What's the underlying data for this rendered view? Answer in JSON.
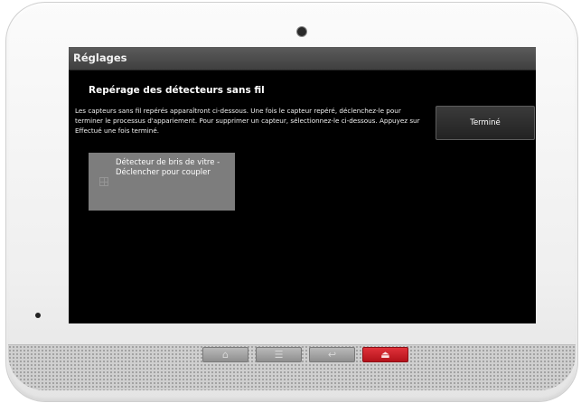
{
  "screen": {
    "title": "Réglages",
    "heading": "Repérage des détecteurs sans fil",
    "instructions": "Les capteurs sans fil repérés apparaîtront ci-dessous. Une fois le capteur repéré, déclenchez-le pour terminer le processus d'appariement. Pour supprimer un capteur, sélectionnez-le ci-dessous. Appuyez sur Effectué une fois terminé.",
    "done_label": "Terminé",
    "sensors": [
      {
        "label": "Détecteur de bris de vitre - Déclencher pour coupler",
        "icon": "sensor-grid-icon"
      }
    ]
  },
  "hardware": {
    "buttons": [
      {
        "name": "home-icon",
        "glyph": "⌂"
      },
      {
        "name": "menu-icon",
        "glyph": "☰"
      },
      {
        "name": "back-icon",
        "glyph": "↩"
      },
      {
        "name": "alarm-icon",
        "glyph": "⏏"
      }
    ],
    "colors": {
      "alarm_button": "#c8161f",
      "screen_bg": "#000000",
      "tile_bg": "#7d7d7d"
    }
  }
}
